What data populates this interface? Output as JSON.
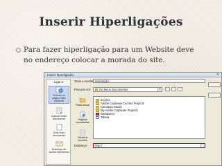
{
  "slide": {
    "title": "Inserir Hiperligações",
    "bullet_line1": "Para fazer hiperligação para um Website deve",
    "bullet_line2": "no endereço colocar a morada do site."
  },
  "dialog": {
    "title": "Inserir hiperligação",
    "link_to_label": "Ligar a:",
    "text_to_display_label": "Texto a mostrar:",
    "text_to_display_value": "Introdução",
    "look_in_label": "Procurar em:",
    "look_in_value": "Os Meus Documentos",
    "address_label": "Endereço:",
    "address_value": "http://",
    "link_buttons": [
      {
        "label": "Ficheiro ou página Web existente",
        "icon": "globe-page-icon",
        "selected": true
      },
      {
        "label": "Colocar neste documento",
        "icon": "document-icon",
        "selected": false
      },
      {
        "label": "Criar novo documento",
        "icon": "new-document-icon",
        "selected": false
      },
      {
        "label": "Endereço de correio electrónico",
        "icon": "email-icon",
        "selected": false
      }
    ],
    "mid_buttons": [
      {
        "label": "Pasta actual",
        "icon": "folder-icon"
      },
      {
        "label": "Páginas consultadas",
        "icon": "browsed-pages-icon"
      },
      {
        "label": "Ficheiros recentes",
        "icon": "recent-files-icon"
      }
    ],
    "files": [
      {
        "name": "acções",
        "type": "folder"
      },
      {
        "name": "Adobe Captivate Cached Projects",
        "type": "folder"
      },
      {
        "name": "Camtasia Studio",
        "type": "folder"
      },
      {
        "name": "My Adobe Captivate Projects",
        "type": "folder"
      },
      {
        "name": "Database1",
        "type": "db"
      },
      {
        "name": "Tabela",
        "type": "doc"
      }
    ]
  }
}
